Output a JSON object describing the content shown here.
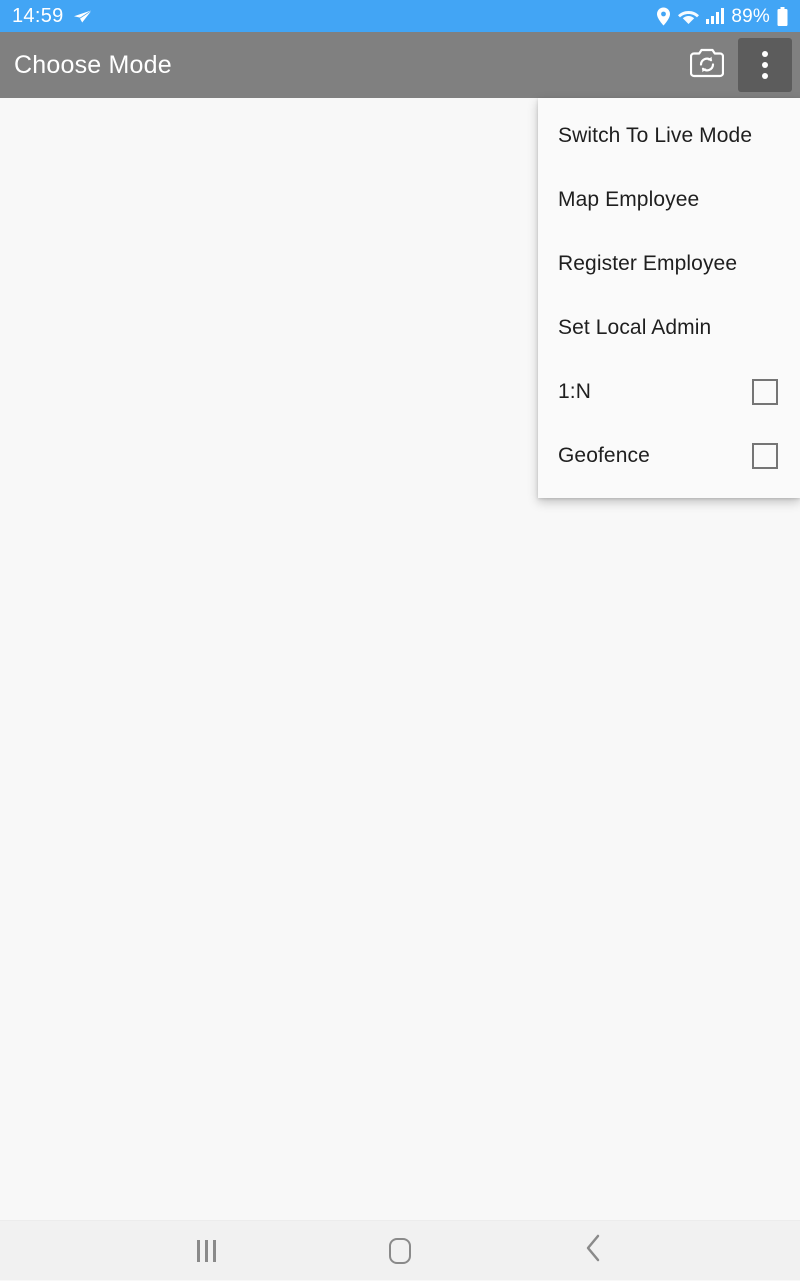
{
  "status_bar": {
    "time": "14:59",
    "telegram_icon": "send-icon",
    "location_icon": "location-pin-icon",
    "wifi_icon": "wifi-icon",
    "signal_icon": "cellular-signal-icon",
    "battery_percent": "89%",
    "battery_icon": "battery-full-icon",
    "background_color": "#42a5f5",
    "text_color": "#ffffff"
  },
  "app_bar": {
    "title": "Choose Mode",
    "background_color": "#808080",
    "camera_switch_icon": "camera-switch-icon",
    "overflow_icon": "more-vertical-icon",
    "overflow_pressed_color": "#5c5c5c"
  },
  "content": {
    "background_color": "#f8f8f8"
  },
  "overflow_menu": {
    "background_color": "#fafafa",
    "items": [
      {
        "label": "Switch To Live Mode",
        "has_checkbox": false,
        "checked": false
      },
      {
        "label": "Map Employee",
        "has_checkbox": false,
        "checked": false
      },
      {
        "label": "Register Employee",
        "has_checkbox": false,
        "checked": false
      },
      {
        "label": "Set Local Admin",
        "has_checkbox": false,
        "checked": false
      },
      {
        "label": "1:N",
        "has_checkbox": true,
        "checked": false
      },
      {
        "label": "Geofence",
        "has_checkbox": true,
        "checked": false
      }
    ]
  },
  "nav_bar": {
    "background_color": "#f1f1f1",
    "recents_icon": "recents-icon",
    "home_icon": "home-icon",
    "back_icon": "back-chevron-icon"
  }
}
